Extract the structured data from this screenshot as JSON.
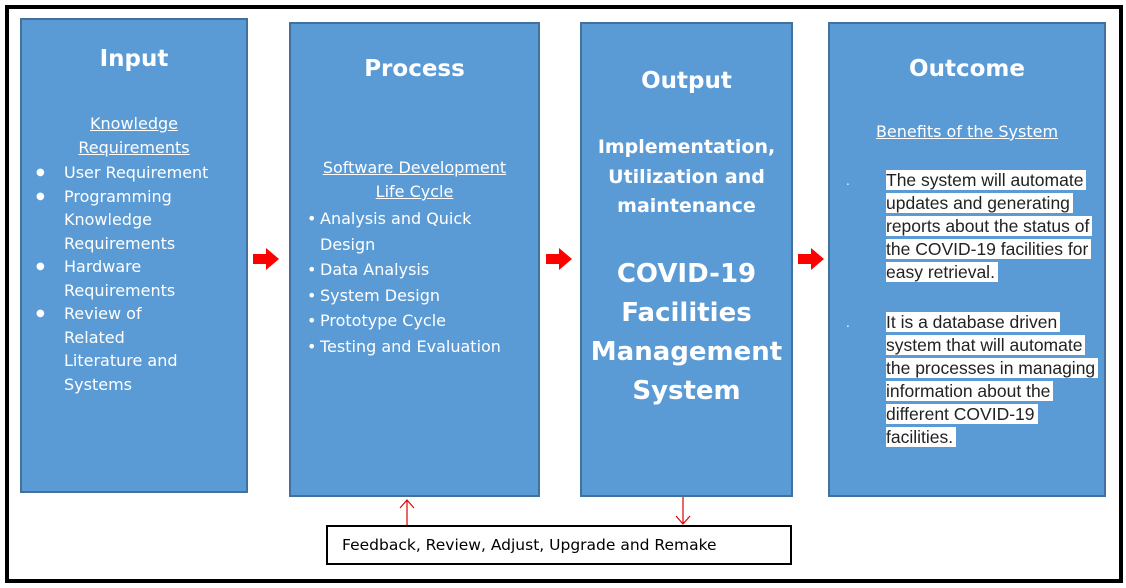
{
  "stages": {
    "input": {
      "title": "Input",
      "subhead_line1": "Knowledge",
      "subhead_line2": "Requirements",
      "items": [
        "User Requirement",
        "Programming Knowledge Requirements",
        "Hardware Requirements",
        "Review of Related Literature and Systems"
      ]
    },
    "process": {
      "title": "Process",
      "subhead_line1": "Software Development",
      "subhead_line2": "Life Cycle",
      "items": [
        "Analysis and Quick Design",
        "Data Analysis",
        "System Design",
        "Prototype Cycle",
        "Testing and Evaluation"
      ]
    },
    "output": {
      "title": "Output",
      "subtitle_line1": "Implementation,",
      "subtitle_line2": "Utilization and",
      "subtitle_line3": "maintenance",
      "system_line1": "COVID-19",
      "system_line2": "Facilities",
      "system_line3": "Management",
      "system_line4": "System"
    },
    "outcome": {
      "title": "Outcome",
      "subhead": "Benefits of the System",
      "bullet_marker": ".",
      "benefits": [
        "The system will automate updates and generating reports about the status of the COVID-19 facilities for easy retrieval.",
        "It is a database driven system that will automate the processes in managing information about the different COVID-19 facilities."
      ]
    }
  },
  "feedback_loop": {
    "label": "Feedback, Review, Adjust, Upgrade and Remake"
  },
  "colors": {
    "box_fill": "#5b9bd5",
    "box_border": "#41719c",
    "arrow": "#ff0000",
    "text_on_box": "#ffffff"
  }
}
